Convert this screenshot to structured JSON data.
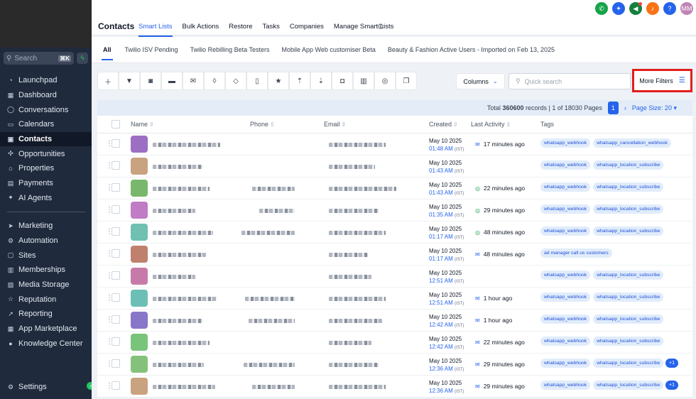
{
  "sidebar": {
    "search_placeholder": "Search",
    "shortcut": "⌘K",
    "items": [
      {
        "label": "Launchpad",
        "icon": "rocket-icon",
        "glyph": "◔"
      },
      {
        "label": "Dashboard",
        "icon": "dashboard-icon",
        "glyph": "▦"
      },
      {
        "label": "Conversations",
        "icon": "chat-icon",
        "glyph": "◯"
      },
      {
        "label": "Calendars",
        "icon": "calendar-icon",
        "glyph": "▭"
      },
      {
        "label": "Contacts",
        "icon": "contacts-icon",
        "glyph": "▣"
      },
      {
        "label": "Opportunities",
        "icon": "opportunities-icon",
        "glyph": "✣"
      },
      {
        "label": "Properties",
        "icon": "home-icon",
        "glyph": "⌂"
      },
      {
        "label": "Payments",
        "icon": "payments-icon",
        "glyph": "▤"
      },
      {
        "label": "AI Agents",
        "icon": "ai-icon",
        "glyph": "✦"
      }
    ],
    "items2": [
      {
        "label": "Marketing",
        "icon": "send-icon",
        "glyph": "➤"
      },
      {
        "label": "Automation",
        "icon": "automation-icon",
        "glyph": "⚙"
      },
      {
        "label": "Sites",
        "icon": "sites-icon",
        "glyph": "▢"
      },
      {
        "label": "Memberships",
        "icon": "memberships-icon",
        "glyph": "▥"
      },
      {
        "label": "Media Storage",
        "icon": "media-icon",
        "glyph": "▨"
      },
      {
        "label": "Reputation",
        "icon": "reputation-icon",
        "glyph": "☆"
      },
      {
        "label": "Reporting",
        "icon": "reporting-icon",
        "glyph": "↗"
      },
      {
        "label": "App Marketplace",
        "icon": "marketplace-icon",
        "glyph": "▦"
      },
      {
        "label": "Knowledge Center",
        "icon": "info-icon",
        "glyph": "●"
      }
    ],
    "settings": "Settings"
  },
  "header": {
    "title": "Contacts",
    "tabs": [
      "Smart Lists",
      "Bulk Actions",
      "Restore",
      "Tasks",
      "Companies",
      "Manage Smart Lists"
    ],
    "avatar_initials": "MM",
    "icon_colors": {
      "phone": "#16a34a",
      "apps": "#2563eb",
      "megaphone": "#15803d",
      "bell": "#f97316",
      "help": "#2563eb",
      "avatar": "#c084b5"
    }
  },
  "list_tabs": [
    "All",
    "Twilio ISV Pending",
    "Twilio Rebilling Beta Testers",
    "Mobile App Web customiser Beta",
    "Beauty & Fashion Active Users - Imported on Feb 13, 2025"
  ],
  "toolbar": {
    "columns_label": "Columns",
    "search_placeholder": "Quick search",
    "more_filters": "More Filters"
  },
  "pagination": {
    "total_prefix": "Total ",
    "total_count": "360600",
    "total_suffix": " records | 1 of 18030 Pages",
    "current_page": "1",
    "page_size": "Page Size: 20"
  },
  "table": {
    "headers": {
      "name": "Name",
      "phone": "Phone",
      "email": "Email",
      "created": "Created",
      "last_activity": "Last Activity",
      "tags": "Tags"
    },
    "rows": [
      {
        "date": "May 10 2025",
        "time": "01:48 AM",
        "tz": "(IST)",
        "activity": "17 minutes ago",
        "act_type": "email",
        "tags": [
          "whatsapp_webhook",
          "whatsapp_cancellation_webhook"
        ],
        "extra": "",
        "avatar": "#9b6fc4"
      },
      {
        "date": "May 10 2025",
        "time": "01:43 AM",
        "tz": "(IST)",
        "activity": "",
        "act_type": "",
        "tags": [
          "whatsapp_webhook",
          "whatsapp_location_subscribe"
        ],
        "extra": "",
        "avatar": "#c9a27f"
      },
      {
        "date": "May 10 2025",
        "time": "01:43 AM",
        "tz": "(IST)",
        "activity": "22 minutes ago",
        "act_type": "whatsapp",
        "tags": [
          "whatsapp_webhook",
          "whatsapp_location_subscribe"
        ],
        "extra": "",
        "avatar": "#79b86c"
      },
      {
        "date": "May 10 2025",
        "time": "01:35 AM",
        "tz": "(IST)",
        "activity": "29 minutes ago",
        "act_type": "whatsapp",
        "tags": [
          "whatsapp_webhook",
          "whatsapp_location_subscribe"
        ],
        "extra": "",
        "avatar": "#c17cc6"
      },
      {
        "date": "May 10 2025",
        "time": "01:17 AM",
        "tz": "(IST)",
        "activity": "48 minutes ago",
        "act_type": "whatsapp",
        "tags": [
          "whatsapp_webhook",
          "whatsapp_location_subscribe"
        ],
        "extra": "",
        "avatar": "#6fc0b0"
      },
      {
        "date": "May 10 2025",
        "time": "01:17 AM",
        "tz": "(IST)",
        "activity": "48 minutes ago",
        "act_type": "email",
        "tags": [
          "ad manager call us customers"
        ],
        "extra": "",
        "avatar": "#c0806e"
      },
      {
        "date": "May 10 2025",
        "time": "12:51 AM",
        "tz": "(IST)",
        "activity": "",
        "act_type": "",
        "tags": [
          "whatsapp_webhook",
          "whatsapp_location_subscribe"
        ],
        "extra": "",
        "avatar": "#c77aa9"
      },
      {
        "date": "May 10 2025",
        "time": "12:51 AM",
        "tz": "(IST)",
        "activity": "1 hour ago",
        "act_type": "email",
        "tags": [
          "whatsapp_webhook",
          "whatsapp_location_subscribe"
        ],
        "extra": "",
        "avatar": "#6cbfb4"
      },
      {
        "date": "May 10 2025",
        "time": "12:42 AM",
        "tz": "(IST)",
        "activity": "1 hour ago",
        "act_type": "email",
        "tags": [
          "whatsapp_webhook",
          "whatsapp_location_subscribe"
        ],
        "extra": "",
        "avatar": "#8877c8"
      },
      {
        "date": "May 10 2025",
        "time": "12:42 AM",
        "tz": "(IST)",
        "activity": "22 minutes ago",
        "act_type": "email",
        "tags": [
          "whatsapp_webhook",
          "whatsapp_location_subscribe"
        ],
        "extra": "",
        "avatar": "#78c47a"
      },
      {
        "date": "May 10 2025",
        "time": "12:36 AM",
        "tz": "(IST)",
        "activity": "29 minutes ago",
        "act_type": "email",
        "tags": [
          "whatsapp_webhook",
          "whatsapp_location_subscribe"
        ],
        "extra": "+1",
        "avatar": "#84c27c"
      },
      {
        "date": "May 10 2025",
        "time": "12:36 AM",
        "tz": "(IST)",
        "activity": "29 minutes ago",
        "act_type": "email",
        "tags": [
          "whatsapp_webhook",
          "whatsapp_location_subscribe"
        ],
        "extra": "+1",
        "avatar": "#c9a27f"
      }
    ]
  }
}
